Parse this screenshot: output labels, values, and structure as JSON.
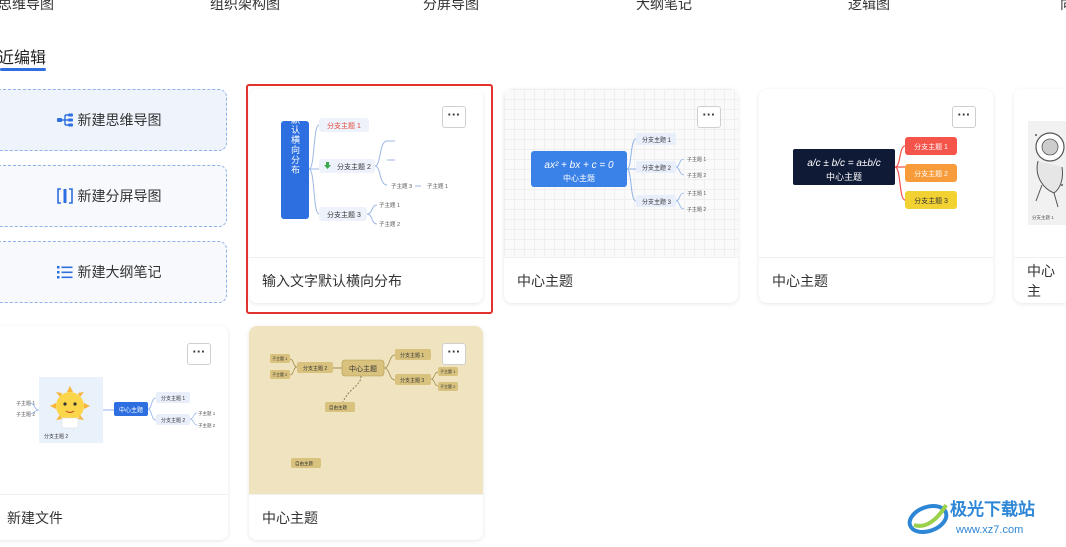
{
  "top_categories": [
    "思维导图",
    "组织架构图",
    "分屏导图",
    "大纲笔记",
    "逻辑图",
    "向"
  ],
  "section": {
    "title": "近编辑"
  },
  "new_actions": [
    {
      "label": "新建思维导图",
      "icon": "mindmap-icon"
    },
    {
      "label": "新建分屏导图",
      "icon": "split-screen-icon"
    },
    {
      "label": "新建大纲笔记",
      "icon": "outline-list-icon"
    }
  ],
  "cards": [
    {
      "name": "输入文字默认横向分布",
      "selected": true,
      "thumb": {
        "root": "输入文字默认横向分布",
        "branches": [
          "分支主题 1",
          "分支主题 2",
          "分支主题 3"
        ],
        "subs": [
          "子主题 3",
          "子主题 1",
          "子主题 1",
          "子主题 2"
        ]
      }
    },
    {
      "name": "中心主题",
      "thumb": {
        "formula": "ax² + bx + c = 0",
        "root": "中心主题",
        "branches": [
          "分支主题 1",
          "分支主题 2",
          "分支主题 3"
        ],
        "subs": [
          "子主题 1",
          "子主题 2",
          "子主题 1",
          "子主题 2"
        ]
      }
    },
    {
      "name": "中心主题",
      "thumb": {
        "formula": "a/c ± b/c = a±b/c",
        "root": "中心主题",
        "branches": [
          "分支主题 1",
          "分支主题 2",
          "分支主题 3"
        ]
      }
    },
    {
      "name": "中心主",
      "thumb": {
        "caption": "分支主题 1"
      }
    },
    {
      "name": "新建文件",
      "thumb": {
        "root": "中心主题",
        "branches": [
          "分支主题 1",
          "分支主题 2"
        ],
        "subs": [
          "子主题 1",
          "子主题 2"
        ],
        "left": [
          "子主题 1",
          "子主题 2"
        ],
        "image_caption": "分支主题 2"
      }
    },
    {
      "name": "中心主题",
      "thumb": {
        "root": "中心主题",
        "branches": [
          "分支主题 1",
          "分支主题 2",
          "分支主题 3"
        ],
        "subs": [
          "子主题 1",
          "子主题 2",
          "子主题 1",
          "子主题 2"
        ],
        "free": [
          "自由主题",
          "自由主题"
        ]
      }
    }
  ],
  "more_label": "···",
  "watermark": {
    "brand": "极光下载站",
    "url": "www.xz7.com"
  },
  "colors": {
    "accent": "#2d6fe0",
    "selected_border": "#e2322c",
    "red": "#f4544a",
    "orange": "#f79b3b",
    "yellow": "#f2d233",
    "navy": "#0f1a36"
  }
}
